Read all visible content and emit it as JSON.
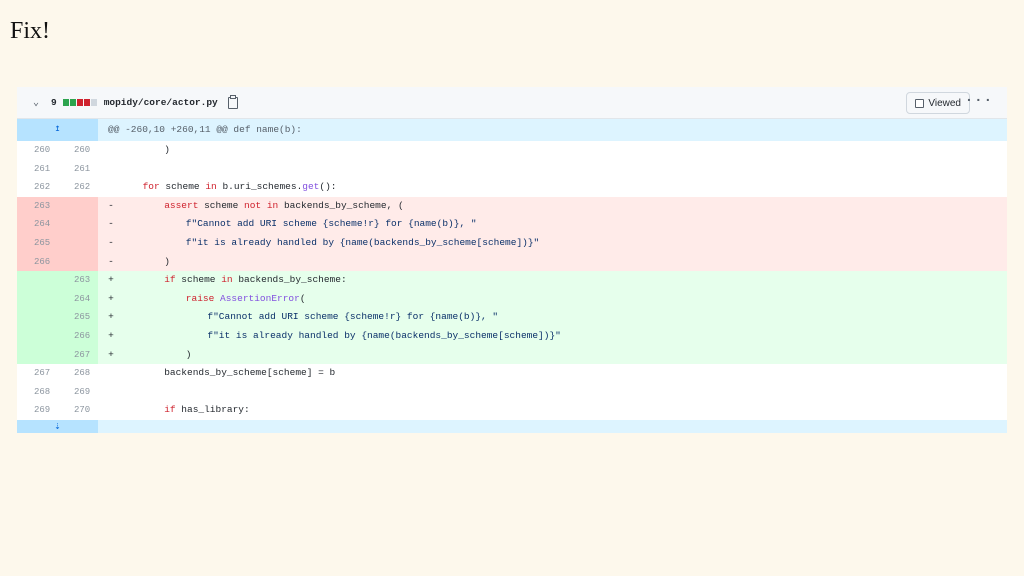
{
  "slide": {
    "title": "Fix!"
  },
  "file": {
    "changes": "9",
    "name": "mopidy/core/actor.py",
    "viewed_label": "Viewed",
    "more": "···"
  },
  "hunk": {
    "expand_up": "↥",
    "header": "@@ -260,10 +260,11 @@ def name(b):",
    "expand_down": "⇣"
  },
  "rows": [
    {
      "type": "ctx",
      "old": "260",
      "new": "260",
      "sign": "",
      "indent": 8,
      "code": ")"
    },
    {
      "type": "ctx",
      "old": "261",
      "new": "261",
      "sign": "",
      "indent": 0,
      "code": ""
    },
    {
      "type": "ctx",
      "old": "262",
      "new": "262",
      "sign": "",
      "indent": 4,
      "code": "for scheme in b.uri_schemes.get():"
    },
    {
      "type": "del",
      "old": "263",
      "new": "",
      "sign": "-",
      "indent": 8,
      "code": "assert scheme not in backends_by_scheme, ("
    },
    {
      "type": "del",
      "old": "264",
      "new": "",
      "sign": "-",
      "indent": 12,
      "code": "f\"Cannot add URI scheme {scheme!r} for {name(b)}, \""
    },
    {
      "type": "del",
      "old": "265",
      "new": "",
      "sign": "-",
      "indent": 12,
      "code": "f\"it is already handled by {name(backends_by_scheme[scheme])}\""
    },
    {
      "type": "del",
      "old": "266",
      "new": "",
      "sign": "-",
      "indent": 8,
      "code": ")"
    },
    {
      "type": "add",
      "old": "",
      "new": "263",
      "sign": "+",
      "indent": 8,
      "code": "if scheme in backends_by_scheme:"
    },
    {
      "type": "add",
      "old": "",
      "new": "264",
      "sign": "+",
      "indent": 12,
      "code": "raise AssertionError("
    },
    {
      "type": "add",
      "old": "",
      "new": "265",
      "sign": "+",
      "indent": 16,
      "code": "f\"Cannot add URI scheme {scheme!r} for {name(b)}, \""
    },
    {
      "type": "add",
      "old": "",
      "new": "266",
      "sign": "+",
      "indent": 16,
      "code": "f\"it is already handled by {name(backends_by_scheme[scheme])}\""
    },
    {
      "type": "add",
      "old": "",
      "new": "267",
      "sign": "+",
      "indent": 12,
      "code": ")"
    },
    {
      "type": "ctx",
      "old": "267",
      "new": "268",
      "sign": "",
      "indent": 8,
      "code": "backends_by_scheme[scheme] = b"
    },
    {
      "type": "ctx",
      "old": "268",
      "new": "269",
      "sign": "",
      "indent": 0,
      "code": ""
    },
    {
      "type": "ctx",
      "old": "269",
      "new": "270",
      "sign": "",
      "indent": 8,
      "code": "if has_library:"
    }
  ]
}
